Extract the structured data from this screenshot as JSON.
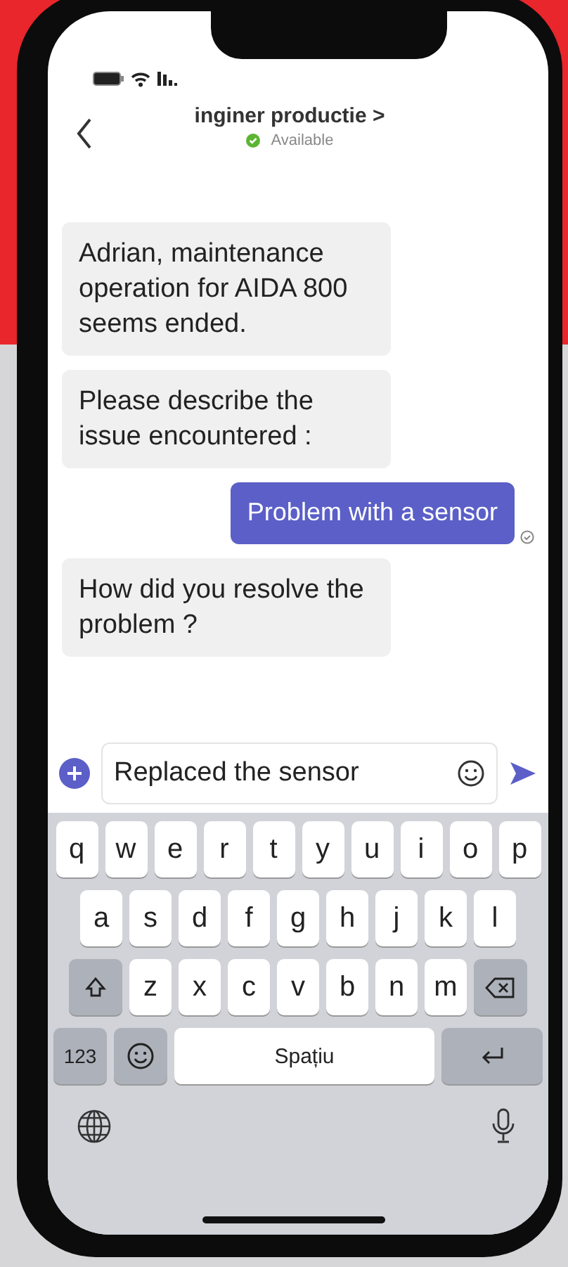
{
  "header": {
    "title": "inginer productie >",
    "status": {
      "label": "Available",
      "color": "#5cb531"
    }
  },
  "messages": [
    {
      "kind": "received",
      "text": "Adrian, maintenance operation for AIDA 800 seems ended."
    },
    {
      "kind": "received",
      "text": "Please describe the issue encountered :"
    },
    {
      "kind": "sent",
      "text": "Problem with a sensor",
      "seen": true
    },
    {
      "kind": "received",
      "text": "How did you resolve the problem ?"
    }
  ],
  "composer": {
    "value": "Replaced the sensor"
  },
  "keyboard": {
    "rows": [
      [
        "q",
        "w",
        "e",
        "r",
        "t",
        "y",
        "u",
        "i",
        "o",
        "p"
      ],
      [
        "a",
        "s",
        "d",
        "f",
        "g",
        "h",
        "j",
        "k",
        "l"
      ],
      [
        "z",
        "x",
        "c",
        "v",
        "b",
        "n",
        "m"
      ]
    ],
    "numbers_key": "123",
    "space_key": "Spațiu"
  }
}
